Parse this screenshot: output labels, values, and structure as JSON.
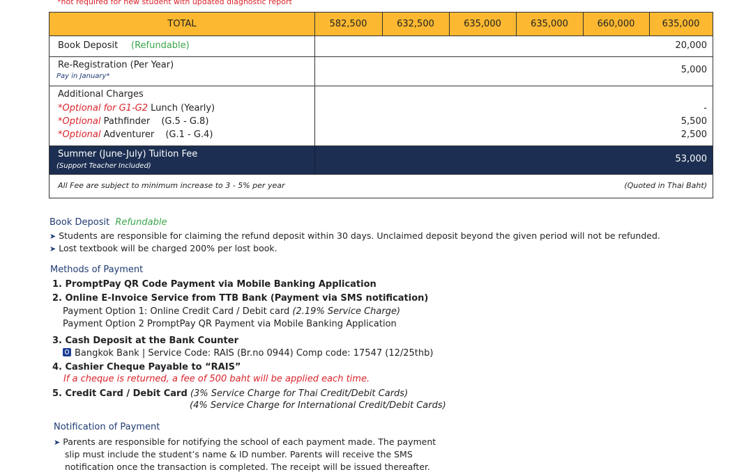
{
  "fee_table": {
    "top_note": "*not required for new student with updated diagnostic report",
    "total": {
      "label": "TOTAL",
      "values": [
        "582,500",
        "632,500",
        "635,000",
        "635,000",
        "660,000",
        "635,000"
      ]
    },
    "book_deposit": {
      "label": "Book Deposit",
      "note": "(Refundable)",
      "value": "20,000"
    },
    "re_registration": {
      "label": "Re-Registration (Per Year)",
      "sub": "Pay in January*",
      "value": "5,000"
    },
    "additional": {
      "title": "Additional Charges",
      "items": [
        {
          "prefix": "*Optional for G1-G2",
          "name": "Lunch",
          "range": "(Yearly)",
          "value": "-"
        },
        {
          "prefix": "*Optional",
          "name": "Pathfinder",
          "range": "(G.5 - G.8)",
          "value": "5,500"
        },
        {
          "prefix": "*Optional",
          "name": "Adventurer",
          "range": "(G.1 - G.4)",
          "value": "2,500"
        }
      ]
    },
    "summer": {
      "label": "Summer (June-July) Tuition Fee",
      "sub": "(Support Teacher Included)",
      "value": "53,000"
    },
    "footer_left": "All Fee are subject to minimum increase to 3 - 5% per year",
    "footer_right": "(Quoted in Thai Baht)"
  },
  "book_deposit_section": {
    "title": "Book Deposit",
    "title_note": "Refundable",
    "bullets": [
      "Students are responsible for claiming the refund deposit within 30 days. Unclaimed deposit beyond the given period will not be refunded.",
      "Lost textbook will be charged 200% per lost book."
    ]
  },
  "payment_methods": {
    "title": "Methods of Payment",
    "m1": "1. PromptPay QR Code Payment via Mobile Banking Application",
    "m2": "2. Online E-Invoice Service from TTB Bank (Payment via SMS notification)",
    "m2_opt1": "Payment Option 1: Online Credit Card / Debit card",
    "m2_opt1_note": "(2.19% Service Charge)",
    "m2_opt2": "Payment Option 2 PromptPay QR Payment via Mobile Banking Application",
    "m3": "3. Cash Deposit at the Bank Counter",
    "m3_detail": "Bangkok Bank | Service Code: RAIS (Br.no 0944) Comp code: 17547 (12/25thb)",
    "m4": "4. Cashier Cheque Payable to “RAIS”",
    "m4_note": "If a cheque is returned, a fee of 500 baht will be applied each time.",
    "m5": "5. Credit Card / Debit Card",
    "m5_note1": "(3% Service Charge for Thai Credit/Debit Cards)",
    "m5_note2": "(4% Service Charge for International Credit/Debit Cards)"
  },
  "notification": {
    "title": "Notification of Payment",
    "lines": [
      "Parents are responsible for notifying the school of each payment made. The payment",
      "slip must include the student’s name & ID number. Parents will receive the SMS",
      "notification once the transaction is completed. The receipt will be issued thereafter."
    ]
  },
  "colors": {
    "total_bg": "#fbb830",
    "navy": "#1c2f52",
    "red": "#d9232a",
    "green": "#3aa64a",
    "blue_text": "#1f3b73"
  }
}
